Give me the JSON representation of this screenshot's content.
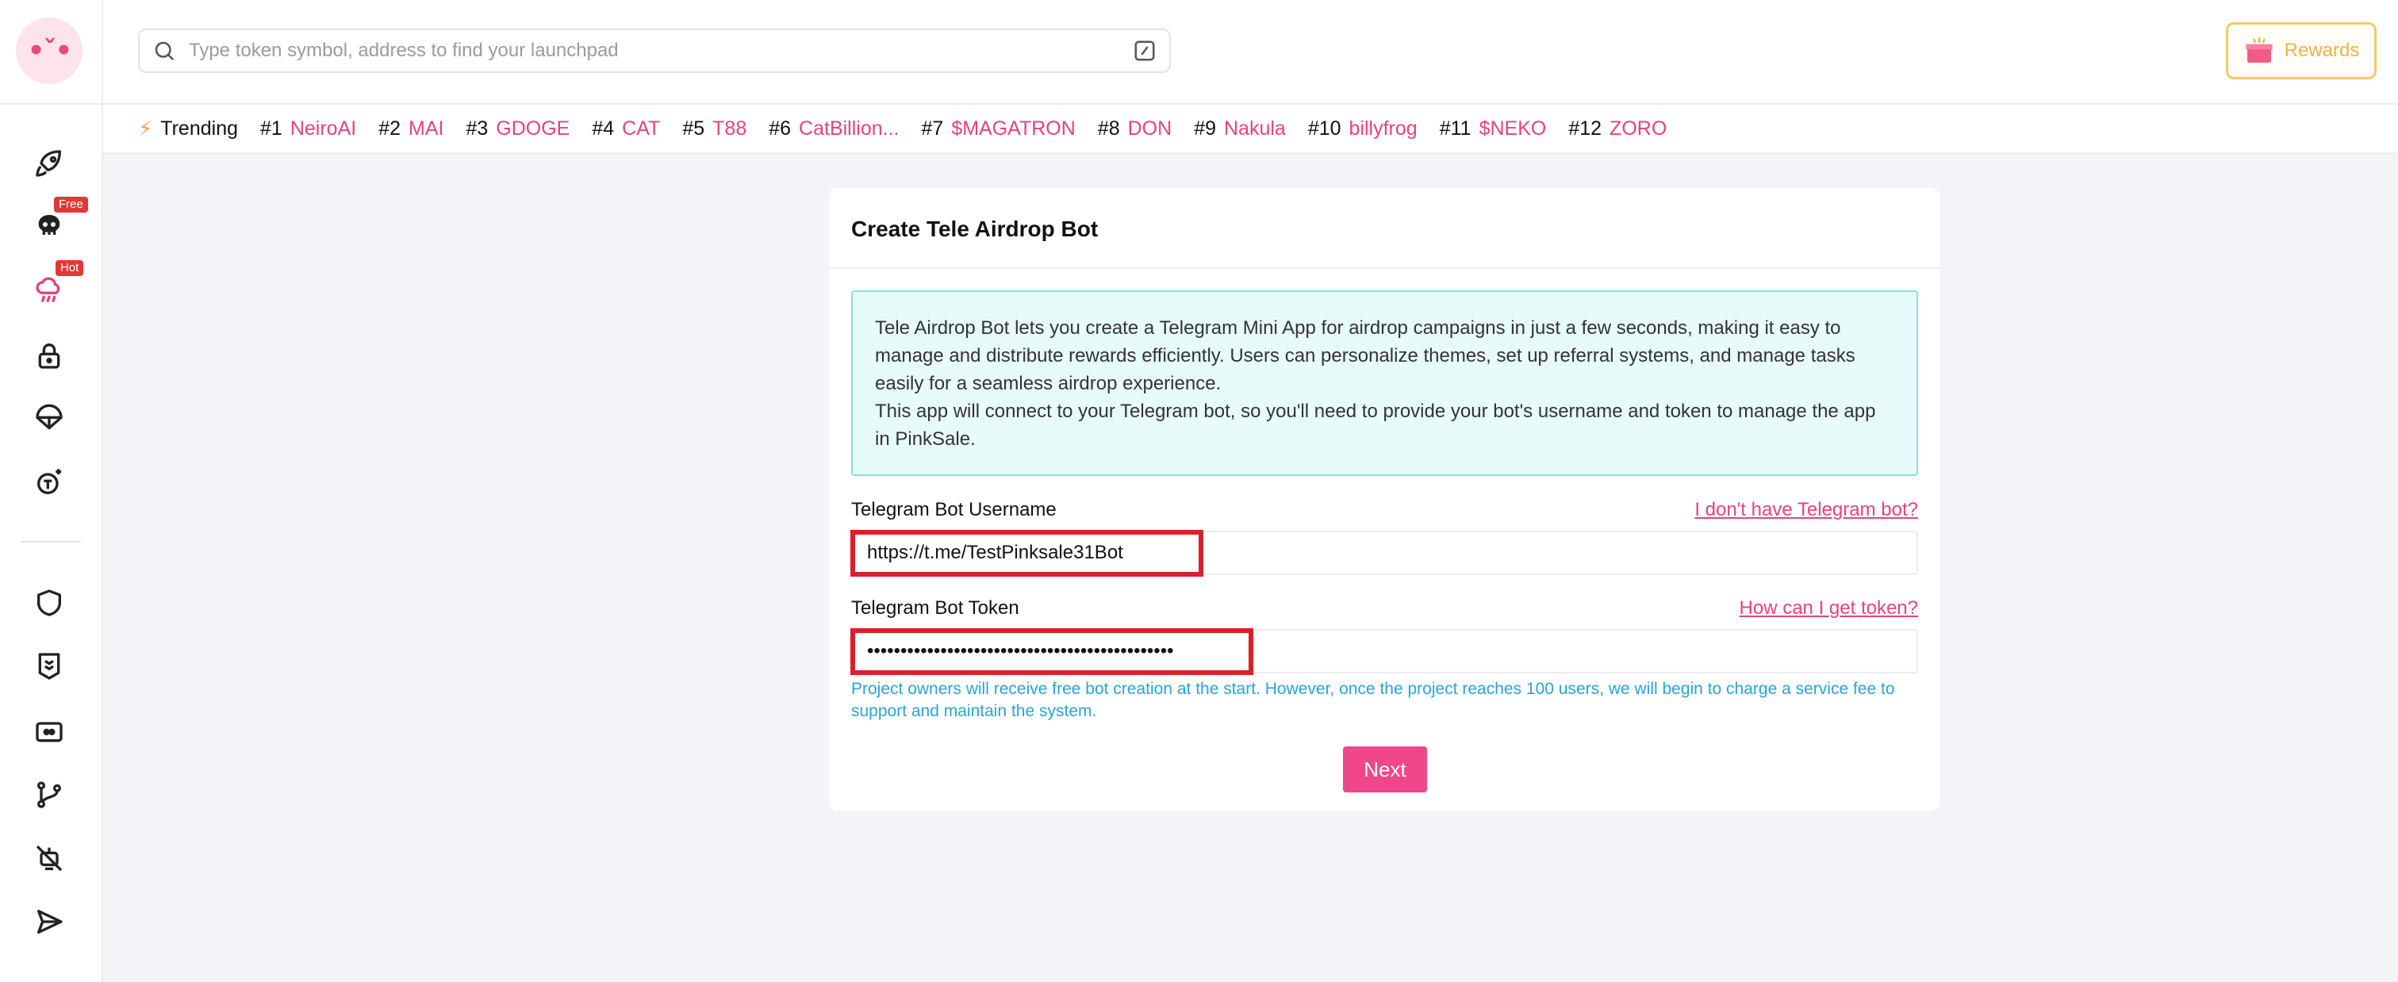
{
  "header": {
    "search_placeholder": "Type token symbol, address to find your launchpad",
    "rewards_label": "Rewards"
  },
  "sidebar": {
    "badges": {
      "free": "Free",
      "hot": "Hot"
    },
    "icons": [
      "rocket-icon",
      "skull-icon",
      "rain-cloud-icon",
      "lock-icon",
      "parachute-icon",
      "token-sparkle-icon",
      "shield-icon",
      "badge-icon",
      "id-card-icon",
      "branch-icon",
      "no-robot-icon",
      "send-icon"
    ]
  },
  "trending": {
    "label": "Trending",
    "items": [
      {
        "rank": "#1",
        "symbol": "NeiroAI"
      },
      {
        "rank": "#2",
        "symbol": "MAI"
      },
      {
        "rank": "#3",
        "symbol": "GDOGE"
      },
      {
        "rank": "#4",
        "symbol": "CAT"
      },
      {
        "rank": "#5",
        "symbol": "T88"
      },
      {
        "rank": "#6",
        "symbol": "CatBillion..."
      },
      {
        "rank": "#7",
        "symbol": "$MAGATRON"
      },
      {
        "rank": "#8",
        "symbol": "DON"
      },
      {
        "rank": "#9",
        "symbol": "Nakula"
      },
      {
        "rank": "#10",
        "symbol": "billyfrog"
      },
      {
        "rank": "#11",
        "symbol": "$NEKO"
      },
      {
        "rank": "#12",
        "symbol": "ZORO"
      }
    ]
  },
  "card": {
    "title": "Create Tele Airdrop Bot",
    "info_line1": "Tele Airdrop Bot lets you create a Telegram Mini App for airdrop campaigns in just a few seconds, making it easy to manage and distribute rewards efficiently. Users can personalize themes, set up referral systems, and manage tasks easily for a seamless airdrop experience.",
    "info_line2": "This app will connect to your Telegram bot, so you'll need to provide your bot's username and token to manage the app in PinkSale.",
    "username_label": "Telegram Bot Username",
    "username_help": "I don't have Telegram bot?",
    "username_value": "https://t.me/TestPinksale31Bot",
    "token_label": "Telegram Bot Token",
    "token_help": "How can I get token?",
    "token_value": "••••••••••••••••••••••••••••••••••••••••••••••",
    "note": "Project owners will receive free bot creation at the start. However, once the project reaches 100 users, we will begin to charge a service fee to support and maintain the system.",
    "next_label": "Next"
  },
  "colors": {
    "accent": "#e8437a",
    "button": "#f0468a",
    "info_bg": "#e7fbfa",
    "info_border": "#8be0dc",
    "note": "#2aa3d8",
    "highlight": "#d9202a",
    "rewards": "#f0b24a"
  }
}
